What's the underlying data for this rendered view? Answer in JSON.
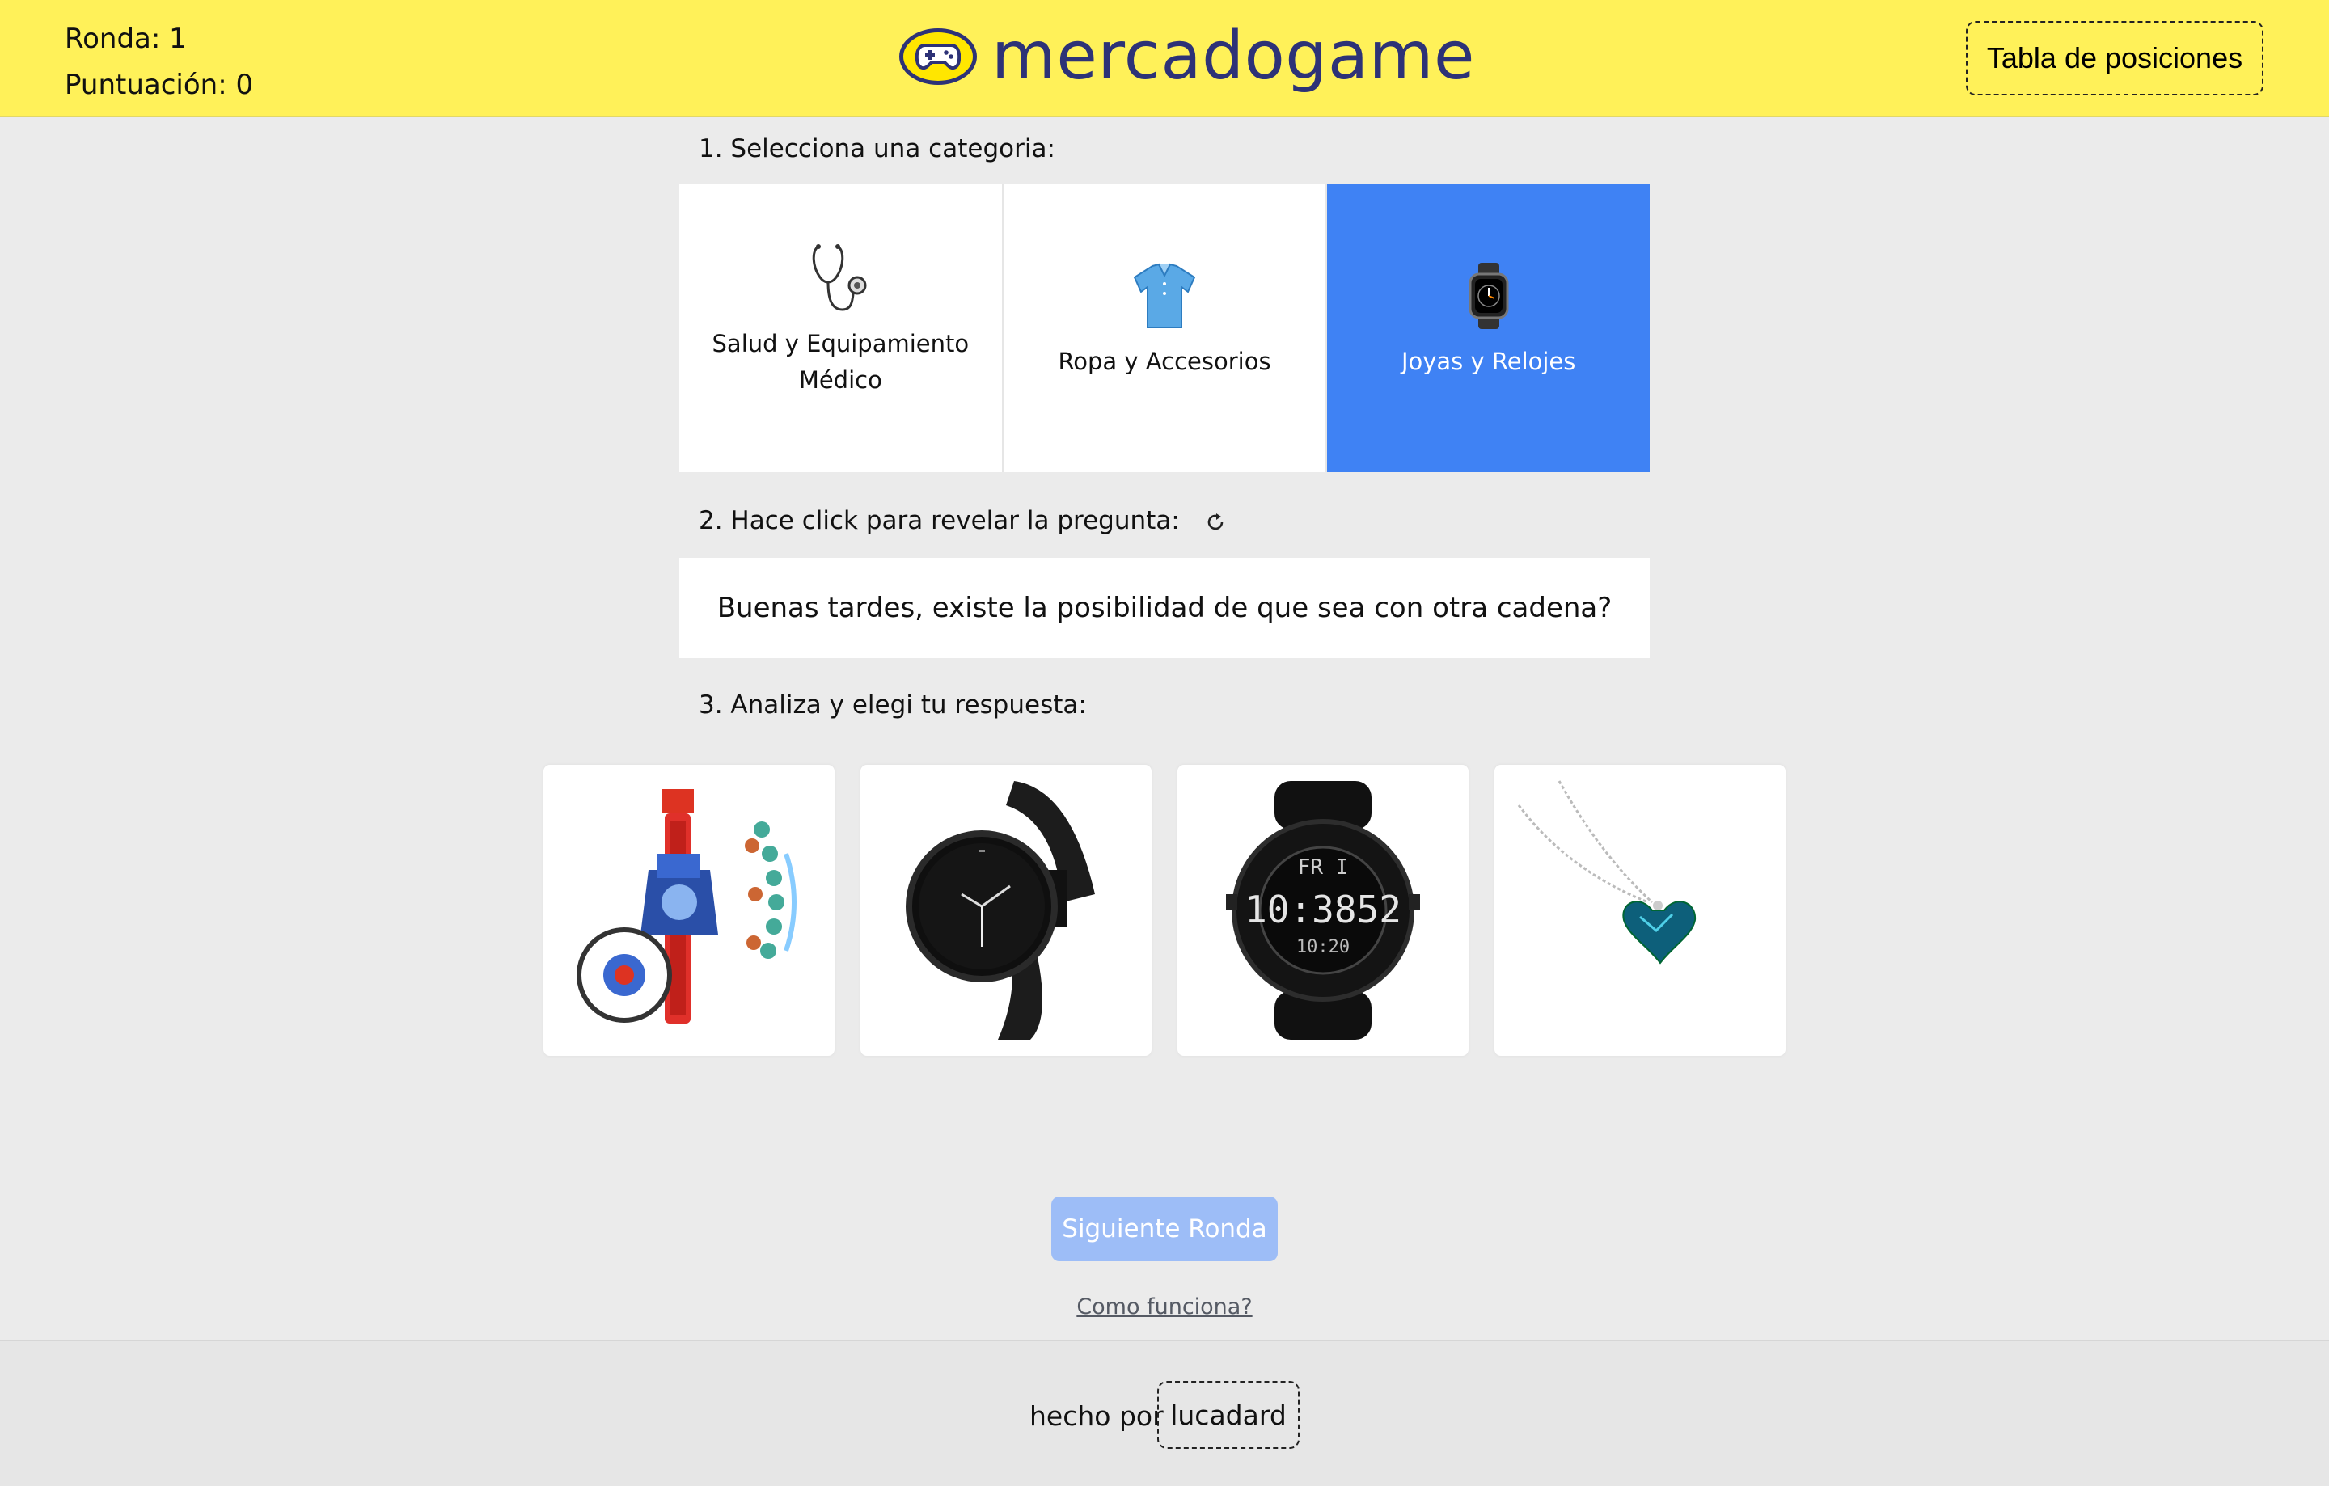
{
  "header": {
    "round_label": "Ronda: 1",
    "score_label": "Puntuación: 0",
    "logo_text": "mercadogame",
    "leaderboard_label": "Tabla de posiciones"
  },
  "step1": {
    "label": "1. Selecciona una categoria:",
    "categories": [
      {
        "name": "Salud y Equipamiento Médico",
        "icon": "stethoscope-icon",
        "selected": false
      },
      {
        "name": "Ropa y Accesorios",
        "icon": "shirt-icon",
        "selected": false
      },
      {
        "name": "Joyas y Relojes",
        "icon": "smartwatch-icon",
        "selected": true
      }
    ]
  },
  "step2": {
    "label": "2. Hace click para revelar la pregunta:",
    "question": "Buenas tardes, existe la posibilidad de que sea con otra cadena?"
  },
  "step3": {
    "label": "3. Analiza y elegi tu respuesta:",
    "answers": [
      {
        "icon": "kids-projector-watch-image"
      },
      {
        "icon": "black-mesh-watch-image"
      },
      {
        "icon": "digital-sport-watch-image"
      },
      {
        "icon": "heart-pendant-necklace-image"
      }
    ]
  },
  "next_button_label": "Siguiente Ronda",
  "how_it_works_label": "Como funciona?",
  "footer": {
    "made_by": "hecho por",
    "author": "lucadard"
  },
  "colors": {
    "header_bg": "#fff159",
    "brand_navy": "#2d3277",
    "selected_blue": "#3f82f4",
    "disabled_button": "#9dbdf7"
  }
}
